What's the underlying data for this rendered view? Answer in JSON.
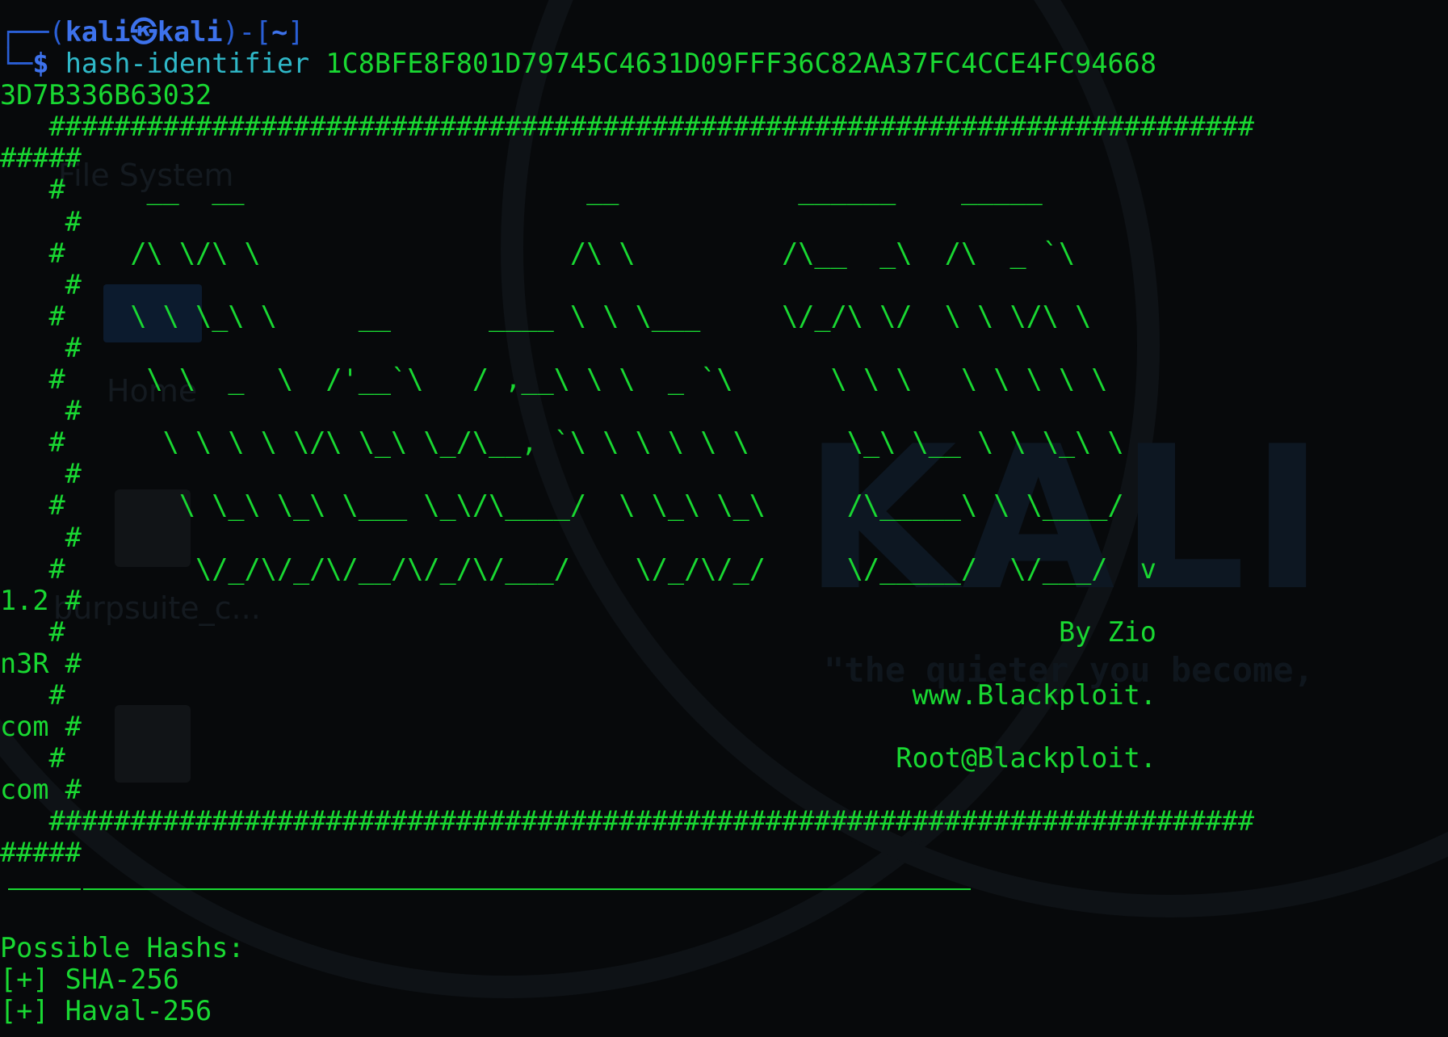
{
  "wallpaper": {
    "logo_text": "KALI",
    "tagline": "\"the quieter you become,",
    "desktop_icons": [
      {
        "label": "File System"
      },
      {
        "label": "Home"
      },
      {
        "label": "burpsuite_c..."
      },
      {
        "label": ""
      }
    ]
  },
  "terminal": {
    "prompt": {
      "open": "┌──(",
      "user_host": "kali㉿kali",
      "close": ")-[",
      "cwd": "~",
      "end": "]",
      "corner": "└─",
      "dollar": "$"
    },
    "command": {
      "name": "hash-identifier",
      "argument": "1C8BFE8F801D79745C4631D09FFF36C82AA37FC4CCE4FC94668"
    },
    "wrapped_lines": [
      "3D7B336B63032",
      "   ##########################################################################",
      "#####",
      "   #     __  __                     __           ______    _____",
      "    #",
      "   #    /\\ \\/\\ \\                   /\\ \\         /\\__  _\\  /\\  _ `\\",
      "    #",
      "   #    \\ \\ \\_\\ \\     __      ____ \\ \\ \\___     \\/_/\\ \\/  \\ \\ \\/\\ \\",
      "    #",
      "   #     \\ \\  _  \\  /'__`\\   / ,__\\ \\ \\  _ `\\      \\ \\ \\   \\ \\ \\ \\ \\",
      "    #",
      "   #      \\ \\ \\ \\ \\/\\ \\_\\ \\_/\\__, `\\ \\ \\ \\ \\ \\      \\_\\ \\__ \\ \\ \\_\\ \\",
      "    #",
      "   #       \\ \\_\\ \\_\\ \\___ \\_\\/\\____/  \\ \\_\\ \\_\\     /\\_____\\ \\ \\____/",
      "    #",
      "   #        \\/_/\\/_/\\/__/\\/_/\\/___/    \\/_/\\/_/     \\/_____/  \\/___/  v",
      "1.2 #",
      "   #                                                             By Zio",
      "n3R #",
      "   #                                                    www.Blackploit.",
      "com #",
      "   #                                                   Root@Blackploit.",
      "com #",
      "   ##########################################################################",
      "#####"
    ],
    "after_rule": [
      "",
      "Possible Hashs:",
      "[+] SHA-256",
      "[+] Haval-256"
    ]
  },
  "colors": {
    "background": "#07090b",
    "banner_green": "#19d832",
    "prompt_blue": "#3d72ec",
    "command_cyan": "#2fb8c8"
  }
}
